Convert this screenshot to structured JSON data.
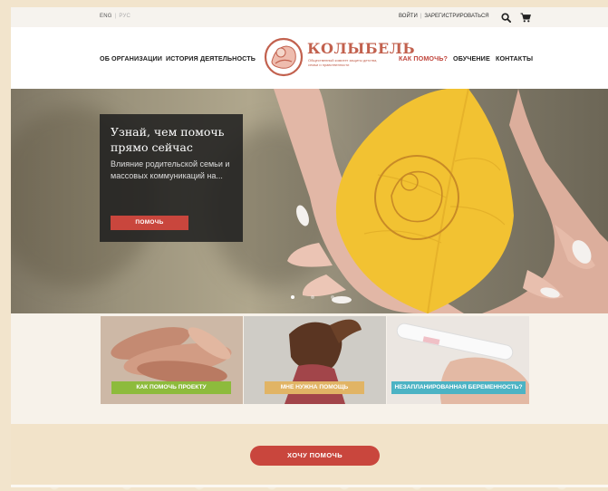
{
  "topbar": {
    "lang_active": "ENG",
    "lang_inactive": "РУС",
    "login": "ВОЙТИ",
    "register": "ЗАРЕГИСТРИРОВАТЬСЯ",
    "search_icon": "search-icon",
    "cart_icon": "cart-icon"
  },
  "nav": {
    "left": [
      "ОБ ОРГАНИЗАЦИИ",
      "ИСТОРИЯ",
      "ДЕЯТЕЛЬНОСТЬ"
    ],
    "right": [
      "КАК ПОМОЧЬ?",
      "ОБУЧЕНИЕ",
      "КОНТАКТЫ"
    ]
  },
  "logo": {
    "title": "КОЛЫБЕЛЬ",
    "subtitle": "Общественный комитет защиты детства, семьи и нравственности"
  },
  "hero": {
    "title": "Узнай, чем помочь прямо сейчас",
    "text": "Влияние родительской семьи и массовых коммуникаций на...",
    "button": "ПОМОЧЬ",
    "slides_count": 3,
    "active_slide": 1
  },
  "tiles": [
    {
      "label": "КАК ПОМОЧЬ ПРОЕКТУ",
      "color": "#8dbb3c"
    },
    {
      "label": "МНЕ НУЖНА ПОМОЩЬ",
      "color": "#e1b465"
    },
    {
      "label": "НЕЗАПЛАНИРОВАННАЯ БЕРЕМЕННОСТЬ?",
      "color": "#4cb3c4"
    }
  ],
  "cta": {
    "label": "ХОЧУ ПОМОЧЬ"
  },
  "colors": {
    "accent": "#c9463d",
    "logo": "#c2614e",
    "leaf": "#f2c232"
  }
}
